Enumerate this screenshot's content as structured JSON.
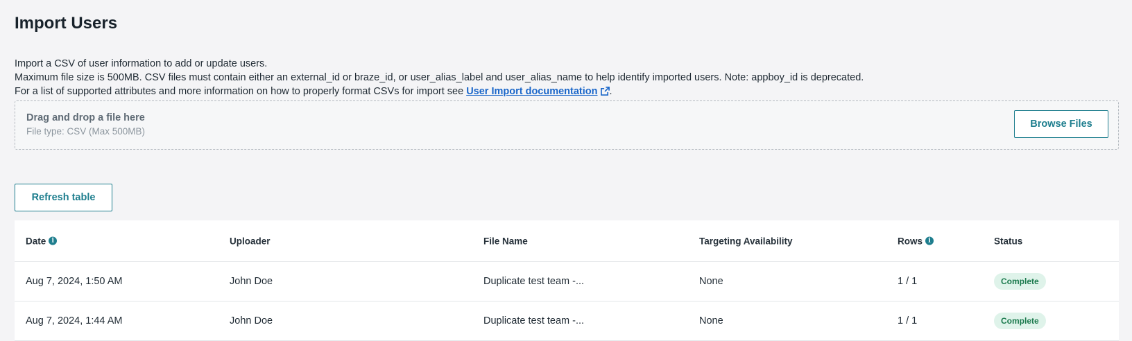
{
  "page": {
    "title": "Import Users",
    "description_line1": "Import a CSV of user information to add or update users.",
    "description_line2": "Maximum file size is 500MB. CSV files must contain either an external_id or braze_id, or user_alias_label and user_alias_name to help identify imported users. Note: appboy_id is deprecated.",
    "description_line3_prefix": "For a list of supported attributes and more information on how to properly format CSVs for import see ",
    "doc_link_label": "User Import documentation",
    "description_line3_suffix": "."
  },
  "dropzone": {
    "title": "Drag and drop a file here",
    "subtitle": "File type: CSV (Max 500MB)",
    "browse_label": "Browse Files"
  },
  "toolbar": {
    "refresh_label": "Refresh table"
  },
  "table": {
    "columns": [
      "Date",
      "Uploader",
      "File Name",
      "Targeting Availability",
      "Rows",
      "Status"
    ],
    "rows": [
      {
        "date": "Aug 7, 2024, 1:50 AM",
        "uploader": "John Doe",
        "file_name": "Duplicate test team -...",
        "targeting": "None",
        "rows": "1 / 1",
        "status": "Complete"
      },
      {
        "date": "Aug 7, 2024, 1:44 AM",
        "uploader": "John Doe",
        "file_name": "Duplicate test team -...",
        "targeting": "None",
        "rows": "1 / 1",
        "status": "Complete"
      }
    ]
  },
  "icons": {
    "info": "info-icon",
    "external_link": "external-link-icon"
  },
  "colors": {
    "accent": "#1e7e8e",
    "link": "#1a66c9",
    "status_complete_bg": "#dff3ea",
    "status_complete_text": "#1b7a4d"
  }
}
